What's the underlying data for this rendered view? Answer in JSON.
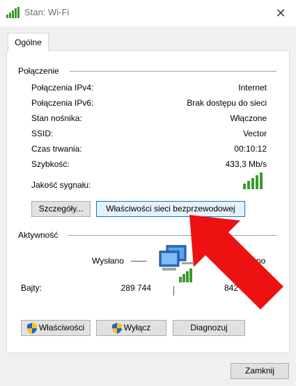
{
  "window": {
    "title": "Stan: Wi-Fi",
    "close_glyph": "✕"
  },
  "tabs": [
    {
      "label": "Ogólne"
    }
  ],
  "connection": {
    "heading": "Połączenie",
    "rows": [
      {
        "label": "Połączenia IPv4:",
        "value": "Internet"
      },
      {
        "label": "Połączenia IPv6:",
        "value": "Brak dostępu do sieci"
      },
      {
        "label": "Stan nośnika:",
        "value": "Włączone"
      },
      {
        "label": "SSID:",
        "value": "Vector"
      },
      {
        "label": "Czas trwania:",
        "value": "00:10:12"
      },
      {
        "label": "Szybkość:",
        "value": "433,3 Mb/s"
      }
    ],
    "signal_label": "Jakość sygnału:",
    "signal_bars": 5,
    "details_button": "Szczegóły...",
    "wireless_props_button": "Właściwości sieci bezprzewodowej"
  },
  "activity": {
    "heading": "Aktywność",
    "sent_label": "Wysłano",
    "received_label_visible": "no",
    "bytes_label": "Bajty:",
    "bytes_sent": "289 744",
    "bytes_received_visible": "842",
    "bytes_received_tail": "0"
  },
  "buttons": {
    "properties": "Właściwości",
    "disable": "Wyłącz",
    "diagnose": "Diagnozuj",
    "close": "Zamknij"
  },
  "colors": {
    "signal_green": "#3a9a2c",
    "arrow_red": "#ee1111",
    "focus_blue": "#0078d7"
  },
  "icons": [
    "wifi-signal-icon",
    "close-icon",
    "network-computers-icon",
    "uac-shield-icon",
    "red-arrow"
  ]
}
